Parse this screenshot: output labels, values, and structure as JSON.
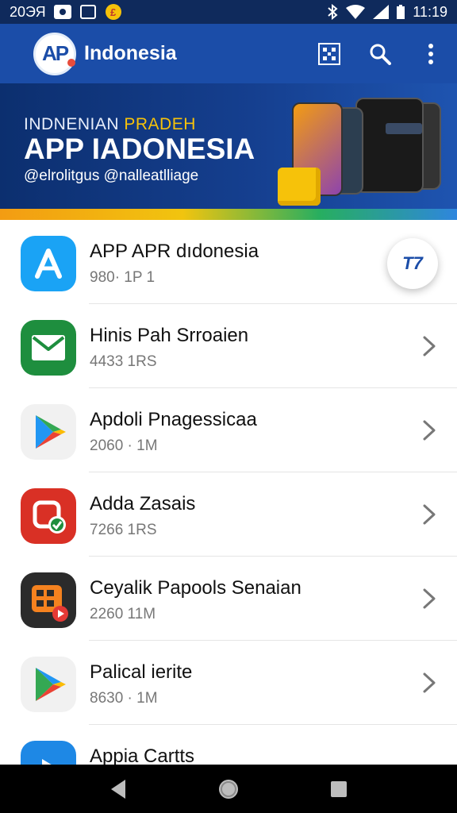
{
  "status_bar": {
    "left_text": "20ЭЯ",
    "time": "11:19"
  },
  "app_bar": {
    "logo_text": "AP",
    "title": "Indonesia"
  },
  "banner": {
    "subtitle_plain": "INDNENIAN ",
    "subtitle_accent": "PRADEH",
    "title": "APP IADONESIA",
    "handle": "@elrolitgus @nalleatlliage"
  },
  "fab": {
    "label": "T7"
  },
  "apps": [
    {
      "name": "APP APR dıdonesia",
      "meta": "980· 1P 1",
      "icon": "app-store-a-icon",
      "color": "#1aa3f5"
    },
    {
      "name": "Hinis Pah Srroaien",
      "meta": "4433 1RS",
      "icon": "mail-envelope-icon",
      "color": "#1e8e3e"
    },
    {
      "name": "Apdoli Pnagessicaa",
      "meta": "2060 · 1M",
      "icon": "play-store-icon",
      "color": "#f1f1f1"
    },
    {
      "name": "Adda Zasais",
      "meta": "7266 1RS",
      "icon": "red-checkmark-app-icon",
      "color": "#d93025"
    },
    {
      "name": "Ceyalik Papools Senaian",
      "meta": "2260 11M",
      "icon": "orange-grid-app-icon",
      "color": "#2b2b2b"
    },
    {
      "name": "Palical ierite",
      "meta": "8630 · 1M",
      "icon": "play-store-icon",
      "color": "#f1f1f1"
    },
    {
      "name": "Appia Cartts",
      "meta": "",
      "icon": "blue-play-app-icon",
      "color": "#1e88e5"
    }
  ],
  "colors": {
    "app_bar": "#1b4da8",
    "status_bar": "#0f2a5c",
    "accent_yellow": "#f6c20a"
  }
}
